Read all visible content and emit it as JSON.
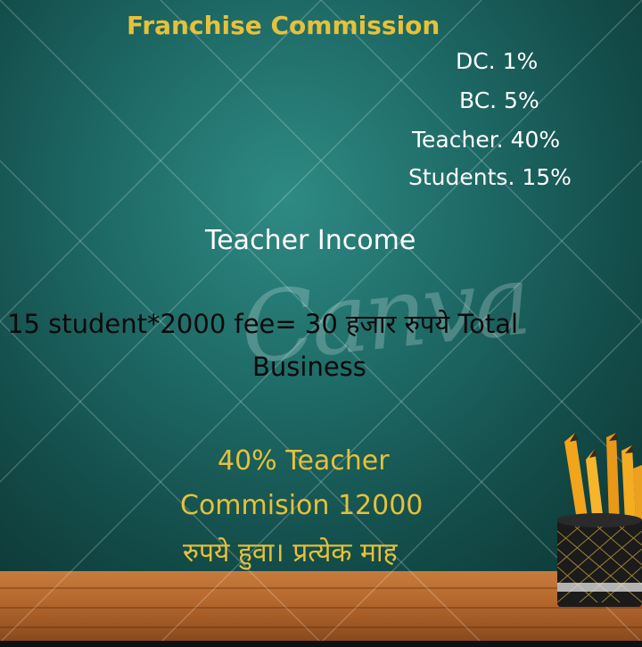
{
  "franchise": {
    "title": "Franchise Commission",
    "items": [
      "DC.  1%",
      "BC. 5%",
      "Teacher. 40%",
      "Students. 15%"
    ]
  },
  "income": {
    "title": "Teacher Income",
    "business_line1": "15 student*2000 fee= 30 हजार रुपये Total",
    "business_line2": "Business"
  },
  "teacher_commission": {
    "line1": "40% Teacher",
    "line2": "Commision 12000",
    "line3": "रुपये हुवा। प्रत्येक माह"
  },
  "watermark": {
    "text": "Canva"
  },
  "colors": {
    "title_yellow": "#e6c13a",
    "white_text": "#ffffff",
    "dark_text": "#0a0a0a",
    "board_teal": "#1f6c68"
  },
  "icons": {
    "pencil_cup": "pencil-cup-icon"
  }
}
